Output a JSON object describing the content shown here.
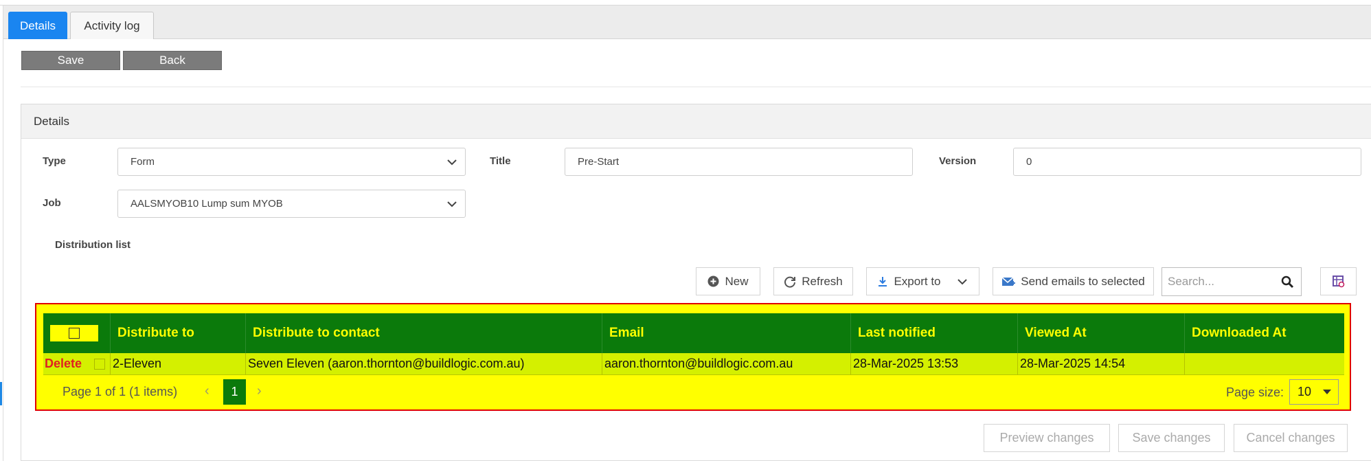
{
  "tabs": [
    {
      "label": "Details",
      "active": true
    },
    {
      "label": "Activity log",
      "active": false
    }
  ],
  "actions": {
    "save": "Save",
    "back": "Back"
  },
  "panel": {
    "title": "Details"
  },
  "form": {
    "type_label": "Type",
    "type_value": "Form",
    "title_label": "Title",
    "title_value": "Pre-Start",
    "version_label": "Version",
    "version_value": "0",
    "job_label": "Job",
    "job_value": "AALSMYOB10 Lump sum MYOB"
  },
  "distribution": {
    "label": "Distribution list",
    "toolbar": {
      "new": "New",
      "refresh": "Refresh",
      "export": "Export to",
      "send": "Send emails to selected",
      "search_placeholder": "Search..."
    },
    "columns": [
      "Distribute to",
      "Distribute to contact",
      "Email",
      "Last notified",
      "Viewed At",
      "Downloaded At"
    ],
    "rows": [
      {
        "action": "Delete",
        "distribute_to": "2-Eleven",
        "contact": "Seven Eleven (aaron.thornton@buildlogic.com.au)",
        "email": "aaron.thornton@buildlogic.com.au",
        "last_notified": "28-Mar-2025 13:53",
        "viewed_at": "28-Mar-2025 14:54",
        "downloaded_at": ""
      }
    ],
    "pager": {
      "info": "Page 1 of 1 (1 items)",
      "current_page": "1",
      "page_size_label": "Page size:",
      "page_size": "10"
    }
  },
  "footer": {
    "preview": "Preview changes",
    "save": "Save changes",
    "cancel": "Cancel changes"
  },
  "colors": {
    "primary": "#1a85f0",
    "grid_header": "#0b7a0b",
    "grid_bg": "#ffff00",
    "row_bg": "#d4f000",
    "delete": "#e02020",
    "grid_border": "#e00000"
  }
}
